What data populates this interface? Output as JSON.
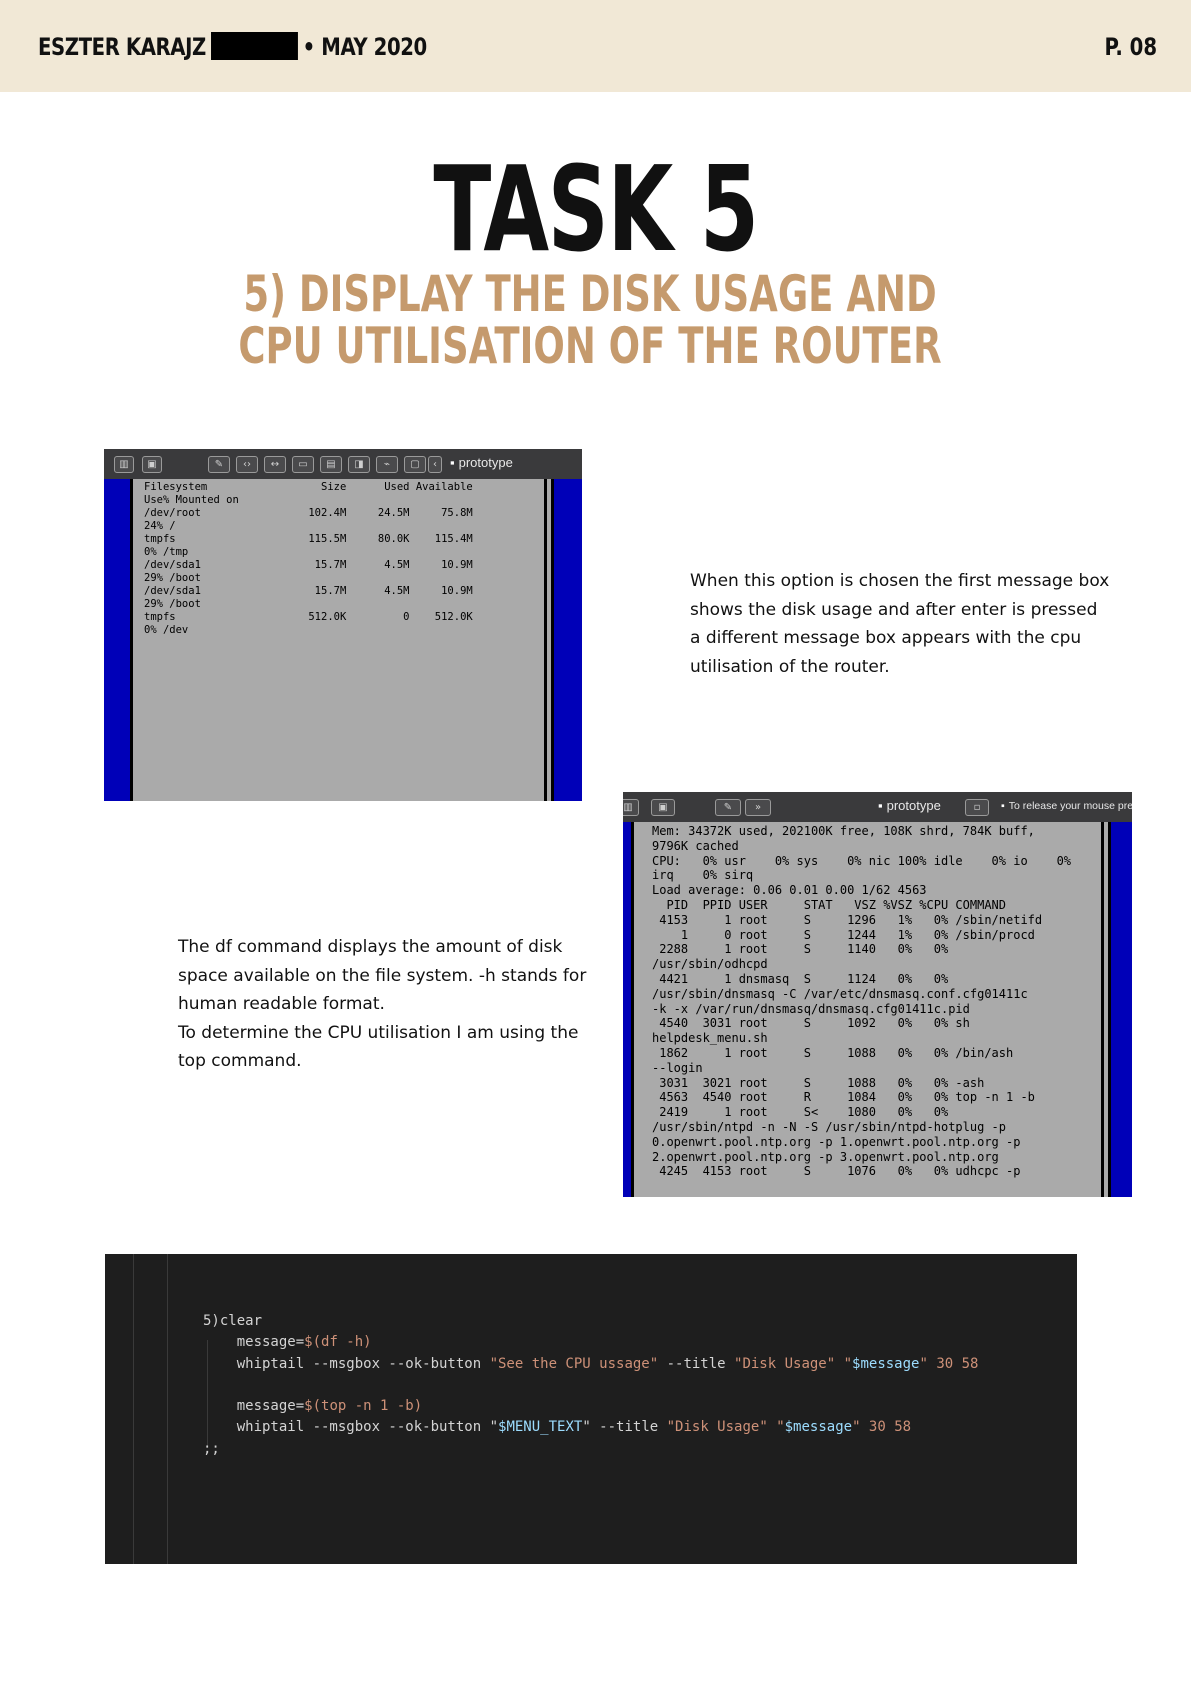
{
  "header": {
    "author": "ESZTER KARAJZ",
    "date": "• MAY 2020",
    "page": "P. 08"
  },
  "title": "TASK 5",
  "subtitle": "5) DISPLAY THE DISK USAGE AND CPU UTILISATION OF THE ROUTER",
  "terminal1": {
    "window_title": "prototype",
    "lines": [
      "Filesystem                  Size      Used Available",
      "Use% Mounted on",
      "/dev/root                 102.4M     24.5M     75.8M",
      "24% /",
      "tmpfs                     115.5M     80.0K    115.4M",
      "0% /tmp",
      "/dev/sda1                  15.7M      4.5M     10.9M",
      "29% /boot",
      "/dev/sda1                  15.7M      4.5M     10.9M",
      "29% /boot",
      "tmpfs                     512.0K         0    512.0K",
      "0% /dev"
    ]
  },
  "paragraph1": "When this option is chosen the first message box shows the disk usage and after enter is pressed a different message box appears with the cpu utilisation of the router.",
  "terminal2": {
    "window_title": "prototype",
    "mouse_hint": "To release your mouse pre",
    "lines": [
      "Mem: 34372K used, 202100K free, 108K shrd, 784K buff,",
      "9796K cached",
      "CPU:   0% usr    0% sys    0% nic 100% idle    0% io    0%",
      "irq    0% sirq",
      "Load average: 0.06 0.01 0.00 1/62 4563",
      "  PID  PPID USER     STAT   VSZ %VSZ %CPU COMMAND",
      " 4153     1 root     S     1296   1%   0% /sbin/netifd",
      "    1     0 root     S     1244   1%   0% /sbin/procd",
      " 2288     1 root     S     1140   0%   0%",
      "/usr/sbin/odhcpd",
      " 4421     1 dnsmasq  S     1124   0%   0%",
      "/usr/sbin/dnsmasq -C /var/etc/dnsmasq.conf.cfg01411c",
      "-k -x /var/run/dnsmasq/dnsmasq.cfg01411c.pid",
      " 4540  3031 root     S     1092   0%   0% sh",
      "helpdesk_menu.sh",
      " 1862     1 root     S     1088   0%   0% /bin/ash",
      "--login",
      " 3031  3021 root     S     1088   0%   0% -ash",
      " 4563  4540 root     R     1084   0%   0% top -n 1 -b",
      " 2419     1 root     S<    1080   0%   0%",
      "/usr/sbin/ntpd -n -N -S /usr/sbin/ntpd-hotplug -p",
      "0.openwrt.pool.ntp.org -p 1.openwrt.pool.ntp.org -p",
      "2.openwrt.pool.ntp.org -p 3.openwrt.pool.ntp.org",
      " 4245  4153 root     S     1076   0%   0% udhcpc -p"
    ]
  },
  "paragraph2": [
    "The df command displays the amount of disk space available on the file system. -h stands for human readable format.",
    "To determine the CPU utilisation I am using the top command."
  ],
  "code": {
    "case": "5)clear",
    "line1_a": "    message=",
    "line1_b": "$(df -h)",
    "line2_a": "    whiptail --msgbox --ok-button ",
    "line2_b": "\"See the CPU ussage\"",
    "line2_c": " --title ",
    "line2_d": "\"Disk Usage\"",
    "line2_e": " \"",
    "line2_f": "$message",
    "line2_g": "\" 30 58",
    "line3_a": "    message=",
    "line3_b": "$(top -n 1 -b)",
    "line4_a": "    whiptail --msgbox --ok-button \"",
    "line4_b": "$MENU_TEXT",
    "line4_c": "\" --title ",
    "line4_d": "\"Disk Usage\"",
    "line4_e": " \"",
    "line4_f": "$message",
    "line4_g": "\" 30 58",
    "end": ";;"
  }
}
